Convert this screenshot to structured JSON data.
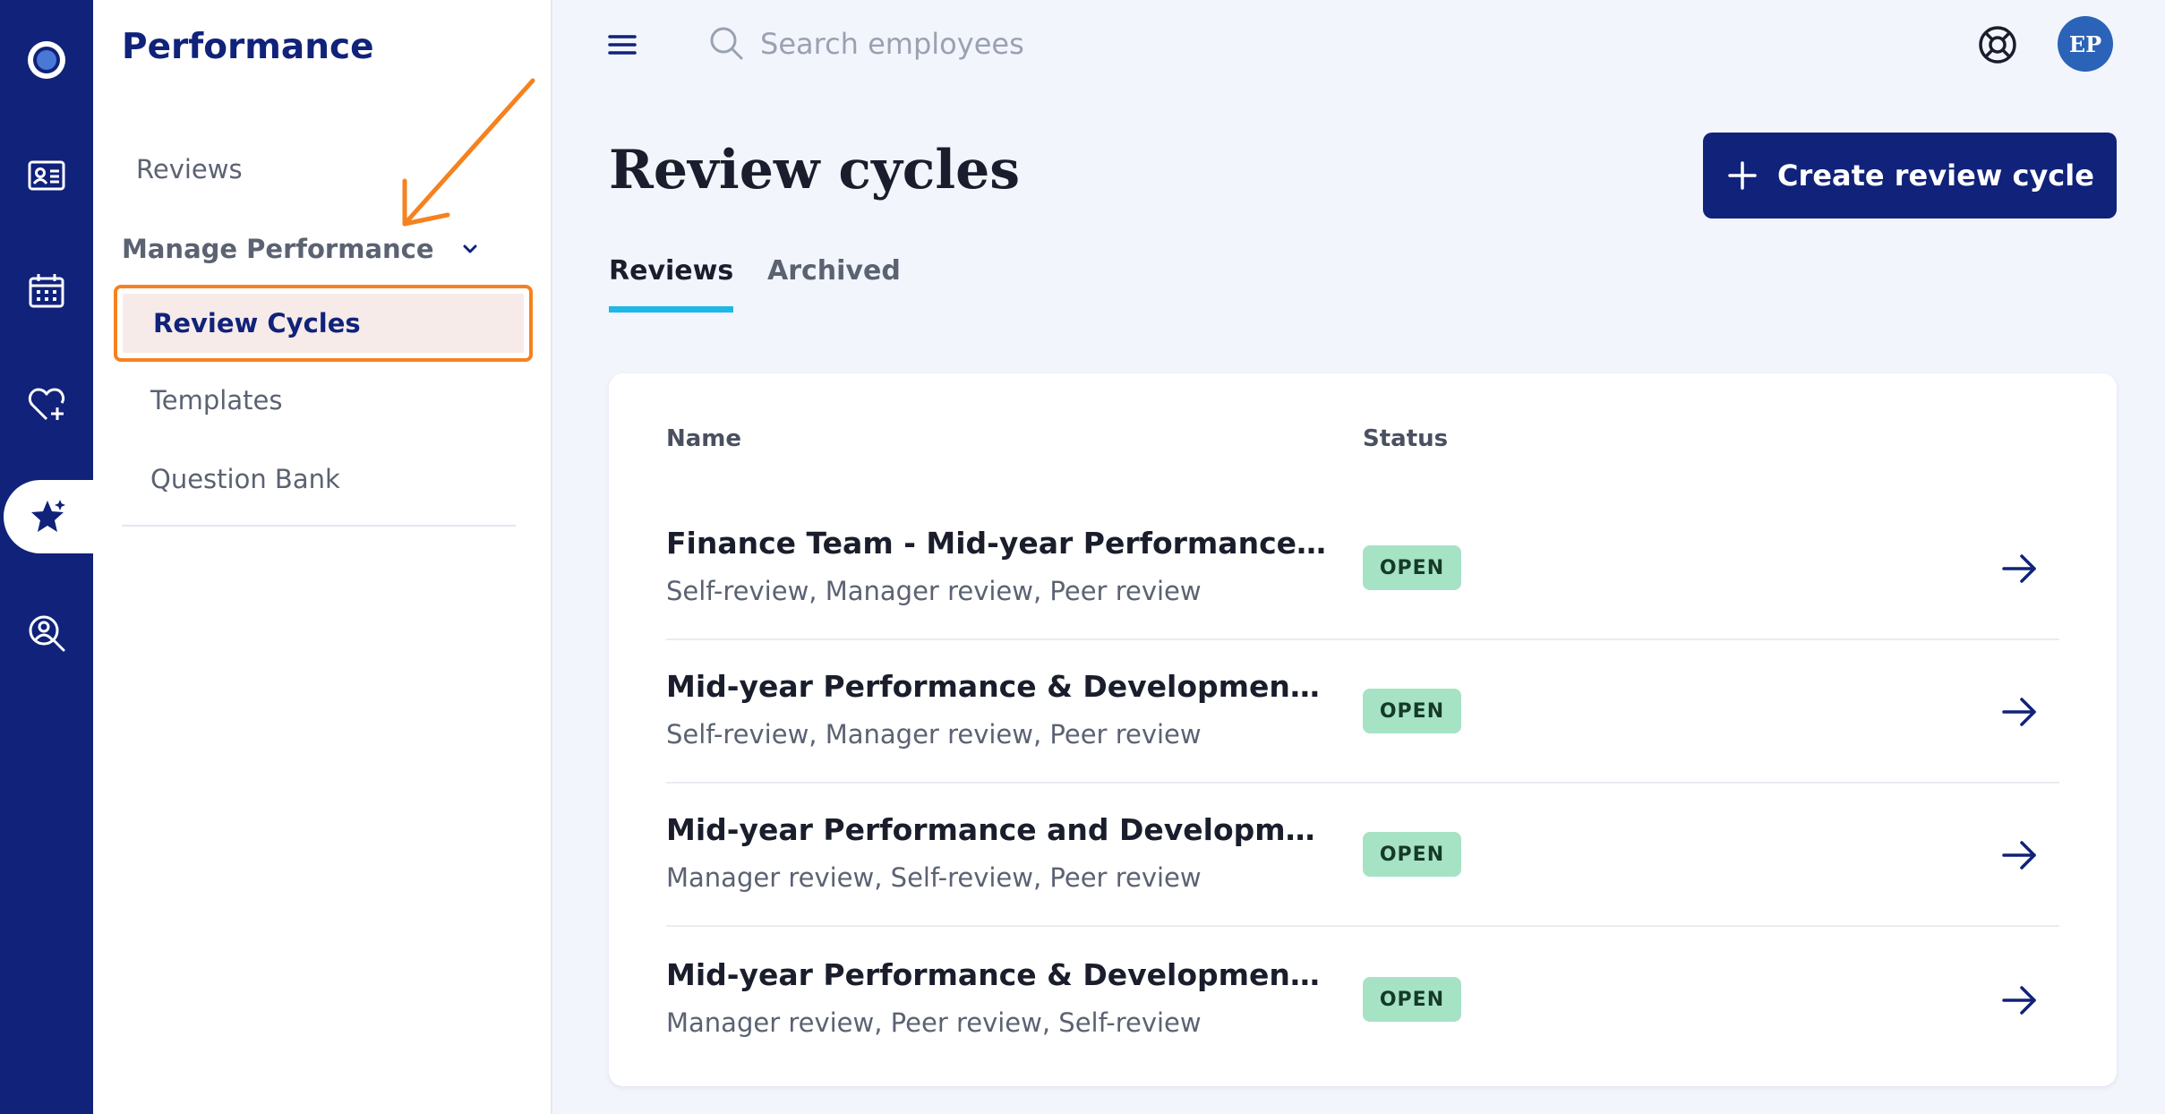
{
  "sidebar": {
    "title": "Performance",
    "reviews_label": "Reviews",
    "manage_label": "Manage Performance",
    "review_cycles_label": "Review Cycles",
    "templates_label": "Templates",
    "question_bank_label": "Question Bank"
  },
  "rail": {
    "icons": [
      "home-icon",
      "directory-icon",
      "calendar-icon",
      "benefits-icon",
      "performance-icon",
      "search-people-icon"
    ],
    "active": "performance-icon"
  },
  "topbar": {
    "search_placeholder": "Search employees",
    "avatar_initials": "EP"
  },
  "main": {
    "title": "Review cycles",
    "create_label": "Create review cycle",
    "tabs": [
      {
        "label": "Reviews",
        "active": true
      },
      {
        "label": "Archived",
        "active": false
      }
    ]
  },
  "table": {
    "col_name": "Name",
    "col_status": "Status",
    "rows": [
      {
        "name": "Finance Team - Mid-year Performance and De-...",
        "types": "Self-review, Manager review, Peer review",
        "status": "OPEN"
      },
      {
        "name": "Mid-year Performance & Development Review...",
        "types": "Self-review, Manager review, Peer review",
        "status": "OPEN"
      },
      {
        "name": "Mid-year Performance and Development...",
        "types": "Manager review, Self-review, Peer review",
        "status": "OPEN"
      },
      {
        "name": "Mid-year Performance & Development Review",
        "types": "Manager review, Peer review, Self-review",
        "status": "OPEN"
      }
    ]
  },
  "colors": {
    "brand": "#10227a",
    "tab_underline": "#1fb6e8",
    "highlight": "#f5821f",
    "status_open_bg": "#a6e3c4"
  }
}
